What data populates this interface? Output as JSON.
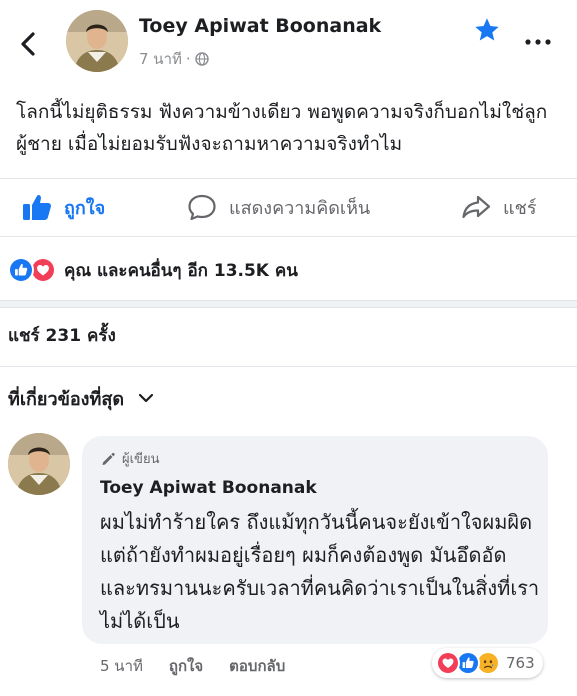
{
  "post": {
    "author": "Toey Apiwat Boonanak",
    "time": "7 นาที",
    "separator": "·",
    "text": "โลกนี้ไม่ยุติธรรม ฟังความข้างเดียว พอพูดความจริงก็บอกไม่ใช่ลูกผู้ชาย เมื่อไม่ยอมรับฟังจะถามหาความจริงทำไม"
  },
  "actions": {
    "like_label": "ถูกใจ",
    "comment_label": "แสดงความคิดเห็น",
    "share_label": "แชร์"
  },
  "reactions_summary": {
    "text": "คุณ และคนอื่นๆ อีก 13.5K คน"
  },
  "shares": {
    "text": "แชร์ 231 ครั้ง"
  },
  "comments_sort": {
    "label": "ที่เกี่ยวข้องที่สุด"
  },
  "comment": {
    "badge": "ผู้เขียน",
    "author": "Toey Apiwat Boonanak",
    "text": "ผมไม่ทำร้ายใคร ถึงแม้ทุกวันนี้คนจะยังเข้าใจผมผิด แต่ถ้ายังทำผมอยู่เรื่อยๆ ผมก็คงต้องพูด มันอึดอัดและทรมานนะครับเวลาที่คนคิดว่าเราเป็นในสิ่งที่เราไม่ได้เป็น",
    "time": "5 นาที",
    "like_label": "ถูกใจ",
    "reply_label": "ตอบกลับ",
    "reaction_count": "763",
    "reaction_icons": [
      "love-icon",
      "like-icon",
      "sad-icon"
    ]
  },
  "colors": {
    "accent": "#1877f2",
    "love": "#f33e58",
    "sad": "#f7b125",
    "muted": "#65676b"
  }
}
